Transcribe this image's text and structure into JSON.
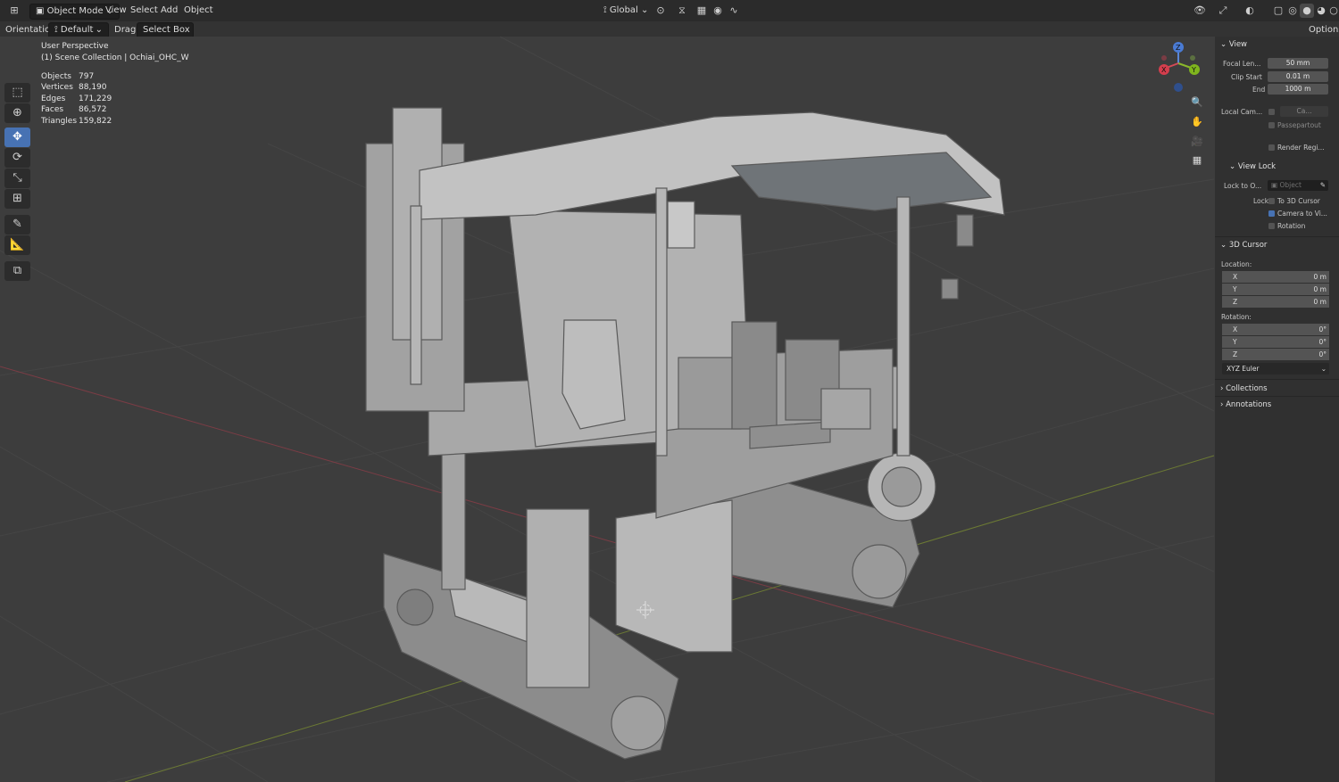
{
  "header": {
    "mode_label": "Object Mode",
    "menu": [
      "View",
      "Select",
      "Add",
      "Object"
    ],
    "orientation_label": "Global",
    "options_label": "Options"
  },
  "tool_header": {
    "orientation_prefix": "Orientation:",
    "orientation_value": "Default",
    "drag_prefix": "Drag:",
    "drag_value": "Select Box"
  },
  "toolbar": {
    "tools": [
      "select-box",
      "cursor",
      "move",
      "rotate",
      "scale",
      "transform",
      "annotate",
      "measure",
      "add-cube"
    ]
  },
  "viewport": {
    "view_name": "User Perspective",
    "collection": "(1) Scene Collection | Ochiai_OHC_W",
    "stats": [
      {
        "label": "Objects",
        "value": "797"
      },
      {
        "label": "Vertices",
        "value": "88,190"
      },
      {
        "label": "Edges",
        "value": "171,229"
      },
      {
        "label": "Faces",
        "value": "86,572"
      },
      {
        "label": "Triangles",
        "value": "159,822"
      }
    ],
    "gizmo": {
      "x": "X",
      "y": "Y",
      "z": "Z"
    }
  },
  "npanel": {
    "view_title": "View",
    "focal_label": "Focal Len...",
    "focal_value": "50 mm",
    "clip_start_label": "Clip Start",
    "clip_start_value": "0.01 m",
    "end_label": "End",
    "end_value": "1000 m",
    "local_cam_label": "Local Cam...",
    "local_cam_value": "Ca...",
    "passepartout_label": "Passepartout",
    "render_region_label": "Render Regi...",
    "view_lock_title": "View Lock",
    "lock_to_label": "Lock to O...",
    "lock_to_placeholder": "Object",
    "lock_label": "Lock",
    "to_cursor_label": "To 3D Cursor",
    "camera_to_view_label": "Camera to Vi...",
    "rotation_lock_label": "Rotation",
    "cursor_title": "3D Cursor",
    "location_label": "Location:",
    "loc": [
      {
        "axis": "X",
        "value": "0 m"
      },
      {
        "axis": "Y",
        "value": "0 m"
      },
      {
        "axis": "Z",
        "value": "0 m"
      }
    ],
    "rotation_label": "Rotation:",
    "rot": [
      {
        "axis": "X",
        "value": "0°"
      },
      {
        "axis": "Y",
        "value": "0°"
      },
      {
        "axis": "Z",
        "value": "0°"
      }
    ],
    "rotation_mode": "XYZ Euler",
    "collections_label": "Collections",
    "annotations_label": "Annotations"
  }
}
